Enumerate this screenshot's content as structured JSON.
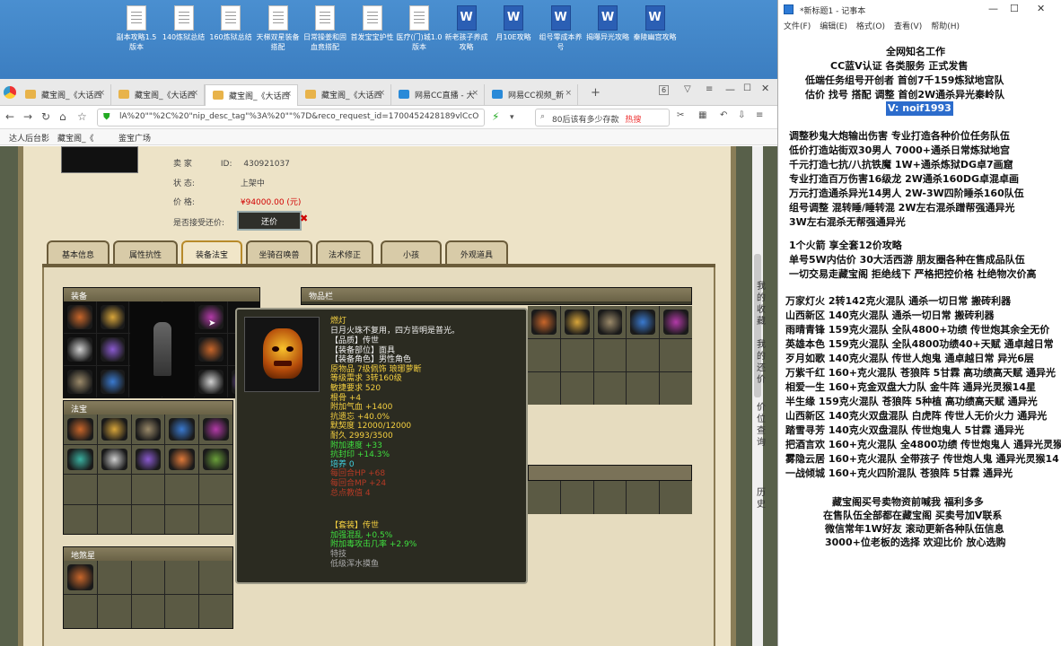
{
  "desktop": {
    "icons": [
      {
        "label": "副本攻略1.5版本",
        "type": "doc"
      },
      {
        "label": "140炼狱总结",
        "type": "doc"
      },
      {
        "label": "160炼狱总结",
        "type": "doc"
      },
      {
        "label": "天梯双星装备搭配",
        "type": "doc"
      },
      {
        "label": "日常操姜和固血竟搭配",
        "type": "doc"
      },
      {
        "label": "首发宝宝护性",
        "type": "doc"
      },
      {
        "label": "医疗(门)城1.0版本",
        "type": "doc"
      },
      {
        "label": "新老孩子养成攻略",
        "type": "word"
      },
      {
        "label": "月10E攻略",
        "type": "word"
      },
      {
        "label": "组号零成本养号",
        "type": "word"
      },
      {
        "label": "揭曝异光攻略",
        "type": "word"
      },
      {
        "label": "秦陵幽宫攻略",
        "type": "word"
      }
    ]
  },
  "browser": {
    "tabs": [
      {
        "label": "藏宝阁_《大话西"
      },
      {
        "label": "藏宝阁_《大话西"
      },
      {
        "label": "藏宝阁_《大话西",
        "active": true
      },
      {
        "label": "藏宝阁_《大话西"
      },
      {
        "label": "网易CC直播 - 大"
      },
      {
        "label": "网易CC视频_新"
      }
    ],
    "tab_count": "6",
    "url": "lA%20\"\"%2C%20\"nip_desc_tag\"%3A%20\"\"%7D&reco_request_id=1700452428189vlCcO",
    "search_text": "80后该有多少存款",
    "search_hot": "热搜",
    "bookmarks": [
      "达人后台影",
      "藏宝阁_《",
      "鉴宝广场"
    ]
  },
  "listing": {
    "seller_label": "卖    家",
    "seller_id_label": "ID:",
    "seller_id": "430921037",
    "status_label": "状    态:",
    "status": "上架中",
    "price_label": "价    格:",
    "price": "¥94000.00 (元)",
    "bargain_label": "是否接受还价:",
    "bargain_button": "还价"
  },
  "game_tabs": [
    "基本信息",
    "属性抗性",
    "装备法宝",
    "坐骑召唤兽",
    "法术修正",
    "小孩",
    "外观道具"
  ],
  "sections": {
    "equip": "装备",
    "items": "物品栏",
    "fabao": "法宝",
    "dizang": "地煞星"
  },
  "tooltip": {
    "name": "燃灯",
    "desc": "日月火珠不复用，四方皆明是普光。",
    "lines": [
      {
        "t": "【品质】传世",
        "c": "cw"
      },
      {
        "t": "【装备部位】面具",
        "c": "cw"
      },
      {
        "t": "【装备角色】男性角色",
        "c": "cw"
      },
      {
        "t": "原物品 7级佩饰 琅琊萝断",
        "c": "cy"
      },
      {
        "t": "等级需求 3转160级",
        "c": "cy"
      },
      {
        "t": "敏捷要求 520",
        "c": "cy"
      },
      {
        "t": "根骨 +4",
        "c": "cy"
      },
      {
        "t": "附加气血 +1400",
        "c": "cy"
      },
      {
        "t": "抗遗忘 +40.0%",
        "c": "cy"
      },
      {
        "t": "默契度 12000/12000",
        "c": "cy"
      },
      {
        "t": "耐久 2993/3500",
        "c": "cy"
      },
      {
        "t": "附加速度 +33",
        "c": "cg"
      },
      {
        "t": "抗封印 +14.3%",
        "c": "cg"
      },
      {
        "t": "培养 0",
        "c": "cc"
      },
      {
        "t": "每回合HP +68",
        "c": "cr"
      },
      {
        "t": "每回合MP +24",
        "c": "cr"
      },
      {
        "t": "总点教值  4",
        "c": "cr"
      }
    ],
    "set_title": "【套装】传世",
    "set_lines": [
      {
        "t": "加强混乱 +0.5%",
        "c": "cg"
      },
      {
        "t": "附加毒攻击几率 +2.9%",
        "c": "cg"
      },
      {
        "t": "特技",
        "c": "cgr"
      },
      {
        "t": "低级浑水摸鱼",
        "c": "cgr"
      }
    ]
  },
  "side_text": [
    "我的收藏",
    "我的还价",
    "价位查询",
    "历史"
  ],
  "notepad": {
    "title": "*新标题1 - 记事本",
    "menu": [
      "文件(F)",
      "编辑(E)",
      "格式(O)",
      "查看(V)",
      "帮助(H)"
    ],
    "lines": [
      "全网知名工作",
      "CC蓝V认证  各类服务  正式发售",
      "低端任务组号开创者          首创7千159炼狱地宫队",
      "估价 找号 搭配 调整          首创2W通杀异光秦岭队",
      "V:  noif1993",
      "调整秒鬼大炮输出伤害          专业打造各种价位任务队伍",
      "低价打造站街双30男人            7000+通杀日常炼狱地宫",
      "千元打造七抗/八抗铁魔          1W+通杀炼狱DG卓7画窟",
      "专业打造百万伤害16级龙          2W通杀160DG卓混卓画",
      "万元打造通杀异光14男人          2W-3W四阶睡杀160队伍",
      "组号调整 混转睡/睡转混          2W左右混杀蹭帮强通异光",
      "                                   3W左右混杀无帮强通异光",
      "1个火箭 享全套12价攻略",
      "单号5W内估价 30大活西游        朋友圈各种在售成品队伍",
      "一切交易走藏宝阁 拒绝线下      严格把控价格 杜绝物次价高",
      "万家灯火 2转142克火混队 通杀一切日常 搬砖利器",
      "山西新区 140克火混队 通杀一切日常 搬砖利器",
      "雨晴青锋 159克火混队 全队4800+功绩 传世炮其余全无价",
      "英雄本色 159克火混队 全队4800功绩40+天赋 通卓越日常",
      "歹月如歌 140克火混队 传世人炮鬼 通卓越日常 异光6层",
      "万紫千红 160+克火混队 苍狼阵 5甘霖 高功绩高天赋 通异光",
      "相爱一生 160+克金双盘大力队 金牛阵 通异光灵猴14星",
      "半生缘    159克火混队 苍狼阵 5种植 高功绩高天赋 通异光",
      "山西新区 140克火双盘混队 白虎阵 传世人无价火力 通异光",
      "踏雪寻芳 140克火双盘混队 传世炮鬼人 5甘霖 通异光",
      "把酒言欢 160+克火混队 全4800功绩 传世炮鬼人 通异光灵猴",
      "雾隐云居 160+克火混队 全带孩子 传世炮人鬼 通异光灵猴14",
      "一战倾城 160+克火四阶混队 苍狼阵 5甘霖 通异光",
      "藏宝阁买号卖物资前喊我 福利多多",
      "在售队伍全部都在藏宝阁 买卖号加V联系",
      "微信常年1W好友 滚动更新各种队伍信息",
      "3000+位老板的选择 欢迎比价 放心选购"
    ]
  }
}
